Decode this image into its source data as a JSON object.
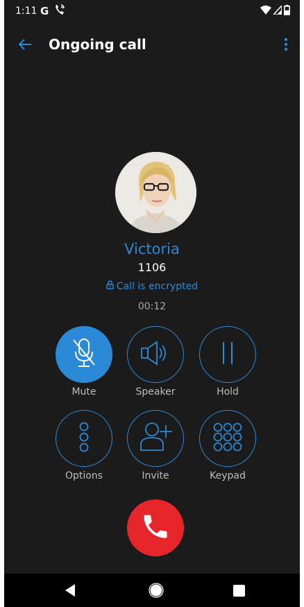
{
  "status_bar": {
    "time": "1:11",
    "g_label": "G"
  },
  "app_bar": {
    "title": "Ongoing call"
  },
  "caller": {
    "name": "Victoria",
    "number": "1106",
    "encryption_status": "Call is encrypted",
    "duration": "00:12"
  },
  "controls": {
    "mute": "Mute",
    "speaker": "Speaker",
    "hold": "Hold",
    "options": "Options",
    "invite": "Invite",
    "keypad": "Keypad"
  },
  "colors": {
    "accent": "#2a8ad8",
    "background": "#1b1b1b",
    "hangup": "#e5252a",
    "label": "#bdbdbd"
  },
  "icons": {
    "back": "arrow-left-icon",
    "overflow": "more-vert-icon",
    "mute": "mic-off-icon",
    "speaker": "speaker-icon",
    "hold": "pause-icon",
    "options": "dots-vertical-icon",
    "invite": "person-add-icon",
    "keypad": "dialpad-icon",
    "hangup": "phone-icon"
  }
}
